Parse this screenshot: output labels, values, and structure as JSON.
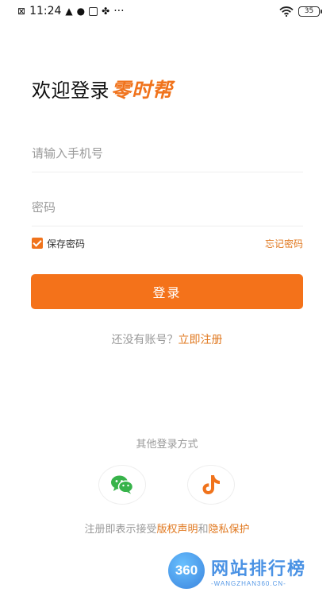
{
  "status_bar": {
    "time": "11:24",
    "more": "···",
    "battery": "35"
  },
  "header": {
    "welcome": "欢迎登录",
    "brand": "零时帮"
  },
  "form": {
    "phone_placeholder": "请输入手机号",
    "password_placeholder": "密码",
    "remember_label": "保存密码",
    "remember_checked": true,
    "forgot_label": "忘记密码",
    "login_label": "登录"
  },
  "register": {
    "prompt": "还没有账号？",
    "link": "立即注册"
  },
  "other_login": {
    "title": "其他登录方式",
    "icons": [
      "wechat-icon",
      "douyin-icon"
    ]
  },
  "agreement": {
    "prefix": "注册即表示接受",
    "copyright_link": "版权声明",
    "conjunction": "和",
    "privacy_link": "隐私保护"
  },
  "watermark": {
    "logo": "360",
    "text": "网站排行榜",
    "subtext": "-WANGZHAN360.CN-"
  },
  "colors": {
    "accent": "#f4721a",
    "link": "#e0781f",
    "muted": "#999999"
  }
}
